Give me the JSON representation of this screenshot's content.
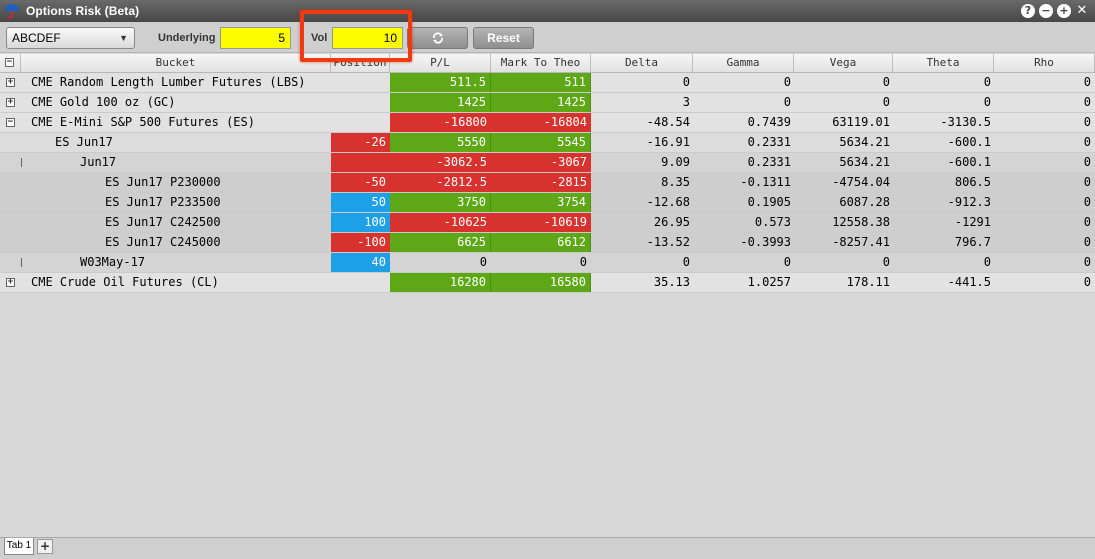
{
  "window": {
    "title": "Options Risk (Beta)"
  },
  "toolbar": {
    "symbol": "ABCDEF",
    "underlying_label": "Underlying",
    "underlying_value": "5",
    "vol_label": "Vol",
    "vol_value": "10",
    "reset_label": "Reset"
  },
  "columns": [
    "Bucket",
    "Position",
    "P/L",
    "Mark To Theo",
    "Delta",
    "Gamma",
    "Vega",
    "Theta",
    "Rho"
  ],
  "rows": [
    {
      "name": "CME Random Length Lumber Futures (LBS)",
      "position": "",
      "pl": "511.5",
      "mtt": "511",
      "delta": "0",
      "gamma": "0",
      "vega": "0",
      "theta": "0",
      "rho": "0"
    },
    {
      "name": "CME Gold 100 oz (GC)",
      "position": "",
      "pl": "1425",
      "mtt": "1425",
      "delta": "3",
      "gamma": "0",
      "vega": "0",
      "theta": "0",
      "rho": "0"
    },
    {
      "name": "CME E-Mini S&P 500 Futures (ES)",
      "position": "",
      "pl": "-16800",
      "mtt": "-16804",
      "delta": "-48.54",
      "gamma": "0.7439",
      "vega": "63119.01",
      "theta": "-3130.5",
      "rho": "0"
    },
    {
      "name": "ES Jun17",
      "position": "-26",
      "pl": "5550",
      "mtt": "5545",
      "delta": "-16.91",
      "gamma": "0.2331",
      "vega": "5634.21",
      "theta": "-600.1",
      "rho": "0"
    },
    {
      "name": "Jun17",
      "position": "",
      "pl": "-3062.5",
      "mtt": "-3067",
      "delta": "9.09",
      "gamma": "0.2331",
      "vega": "5634.21",
      "theta": "-600.1",
      "rho": "0"
    },
    {
      "name": "ES Jun17 P230000",
      "position": "-50",
      "pl": "-2812.5",
      "mtt": "-2815",
      "delta": "8.35",
      "gamma": "-0.1311",
      "vega": "-4754.04",
      "theta": "806.5",
      "rho": "0"
    },
    {
      "name": "ES Jun17 P233500",
      "position": "50",
      "pl": "3750",
      "mtt": "3754",
      "delta": "-12.68",
      "gamma": "0.1905",
      "vega": "6087.28",
      "theta": "-912.3",
      "rho": "0"
    },
    {
      "name": "ES Jun17 C242500",
      "position": "100",
      "pl": "-10625",
      "mtt": "-10619",
      "delta": "26.95",
      "gamma": "0.573",
      "vega": "12558.38",
      "theta": "-1291",
      "rho": "0"
    },
    {
      "name": "ES Jun17 C245000",
      "position": "-100",
      "pl": "6625",
      "mtt": "6612",
      "delta": "-13.52",
      "gamma": "-0.3993",
      "vega": "-8257.41",
      "theta": "796.7",
      "rho": "0"
    },
    {
      "name": "W03May-17",
      "position": "40",
      "pl": "0",
      "mtt": "0",
      "delta": "0",
      "gamma": "0",
      "vega": "0",
      "theta": "0",
      "rho": "0"
    },
    {
      "name": "CME Crude Oil Futures (CL)",
      "position": "",
      "pl": "16280",
      "mtt": "16580",
      "delta": "35.13",
      "gamma": "1.0257",
      "vega": "178.11",
      "theta": "-441.5",
      "rho": "0"
    }
  ],
  "tabs": {
    "tab1": "Tab 1",
    "add": "+"
  },
  "colors": {
    "positive": "#5ea818",
    "negative": "#d8322f",
    "long_position": "#1ea0e6",
    "highlight": "#f03a13",
    "input": "#fdfd00"
  }
}
